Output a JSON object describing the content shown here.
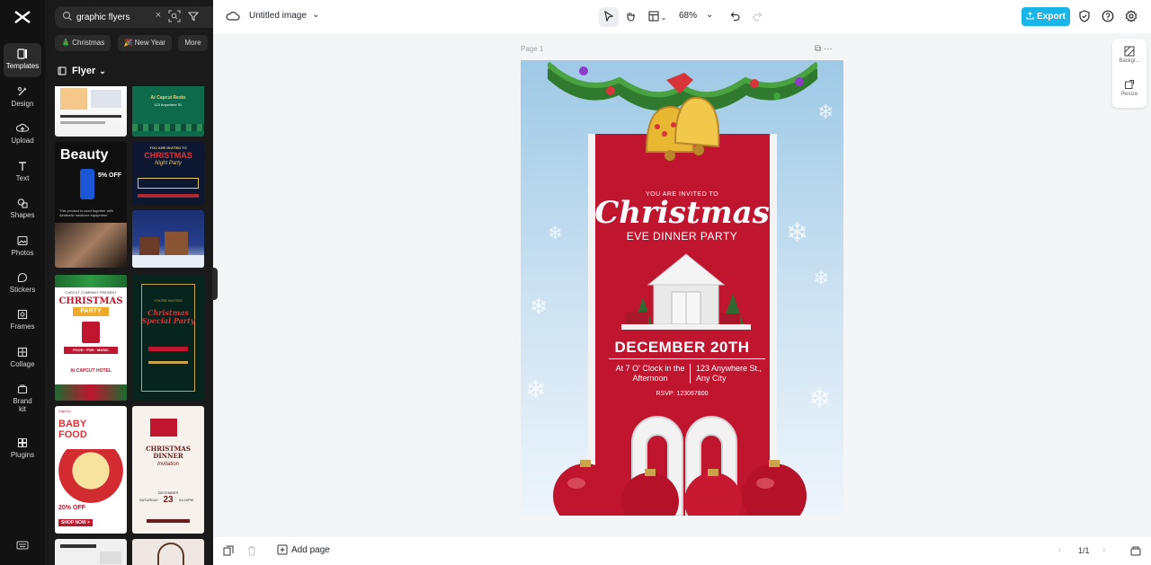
{
  "rail": {
    "items": [
      {
        "label": "Templates",
        "icon": "templates-icon"
      },
      {
        "label": "Design",
        "icon": "design-icon"
      },
      {
        "label": "Upload",
        "icon": "upload-icon"
      },
      {
        "label": "Text",
        "icon": "text-icon"
      },
      {
        "label": "Shapes",
        "icon": "shapes-icon"
      },
      {
        "label": "Photos",
        "icon": "photos-icon"
      },
      {
        "label": "Stickers",
        "icon": "stickers-icon"
      },
      {
        "label": "Frames",
        "icon": "frames-icon"
      },
      {
        "label": "Collage",
        "icon": "collage-icon"
      },
      {
        "label": "Brand kit",
        "icon": "brand-kit-icon"
      },
      {
        "label": "Plugins",
        "icon": "plugins-icon"
      }
    ]
  },
  "panel": {
    "search_value": "graphic flyers",
    "clear_glyph": "×",
    "chips": [
      "🎄 Christmas",
      "🎉 New Year",
      "More"
    ],
    "category": "Flyer"
  },
  "thumbs": {
    "t1": {
      "line1": "",
      "line2": ""
    },
    "t2": {
      "line1": "At Capcut Resto",
      "line2": "123 Anywhere St."
    },
    "t3": {
      "title": "Beauty",
      "badge": "5% OFF",
      "caption": "This product is used together with Aesthetic medicine equipment"
    },
    "t4": {
      "top": "YOU ARE INVITED TO",
      "title": "CHRISTMAS",
      "sub": "Night Party"
    },
    "t6": {
      "company": "CAPCUT COMPANY PRESENT",
      "title": "CHRISTMAS",
      "sub": "PARTY",
      "items": "FOOD · FUN · MUSIC",
      "venue": "At CAPCUT HOTEL"
    },
    "t7": {
      "top": "YOU'RE INVITED",
      "title": "Christmas Special Party"
    },
    "t8": {
      "brand": "CapCut",
      "title": "BABY FOOD",
      "offer": "20% OFF",
      "cta": "SHOP NOW >"
    },
    "t9": {
      "title": "CHRISTMAS DINNER",
      "sub": "Invitation",
      "month": "DECEMBER",
      "day": "23",
      "weekday": "SATURDAY",
      "time": "04.00PM"
    }
  },
  "topbar": {
    "title": "Untitled image",
    "zoom": "68%",
    "export_label": "Export"
  },
  "canvas": {
    "page_label": "Page 1",
    "page_actions": "⧉   ···"
  },
  "flyer": {
    "invited": "YOU ARE INVITED TO",
    "title": "Christmas",
    "subtitle": "EVE DINNER PARTY",
    "date": "DECEMBER 20TH",
    "time": "At 7 O' Clock in the Afternoon",
    "address": "123 Anywhere St., Any City",
    "rsvp": "RSVP: 123067800"
  },
  "side_tools": {
    "background": "Backgr...",
    "resize": "Resize"
  },
  "bottombar": {
    "add_page": "Add page",
    "pager": "1/1"
  },
  "colors": {
    "accent": "#19b4e8",
    "flyer_red": "#c0152f",
    "rail_bg": "#121212"
  }
}
